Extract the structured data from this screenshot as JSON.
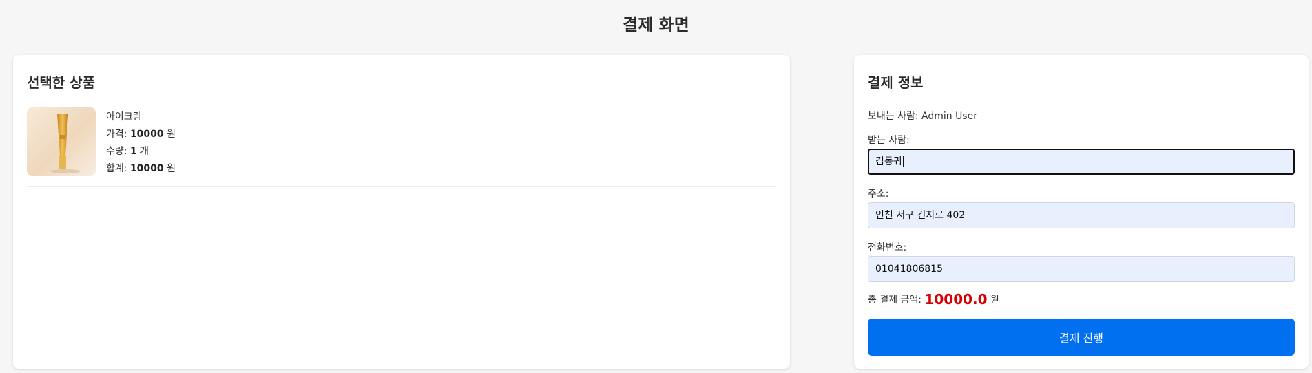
{
  "page": {
    "title": "결제 화면"
  },
  "selected_products": {
    "heading": "선택한 상품",
    "items": [
      {
        "name": "아이크림",
        "price_label": "가격: ",
        "price": "10000",
        "price_unit": " 원",
        "quantity_label": "수량: ",
        "quantity": "1",
        "quantity_unit": " 개",
        "subtotal_label": "합계: ",
        "subtotal": "10000",
        "subtotal_unit": " 원"
      }
    ]
  },
  "payment_info": {
    "heading": "결제 정보",
    "sender": "보내는 사람: Admin User",
    "recipient_label": "받는 사람:",
    "recipient_value": "김동귀",
    "address_label": "주소:",
    "address_value": "인천 서구 건지로 402",
    "phone_label": "전화번호:",
    "phone_value": "01041806815",
    "total_label": "총 결제 금액: ",
    "total_amount": "10000.0",
    "total_unit": " 원",
    "submit_label": "결제 진행"
  },
  "colors": {
    "accent": "#0070f0",
    "total_amount": "#d60000",
    "input_bg": "#e8f0fe"
  }
}
